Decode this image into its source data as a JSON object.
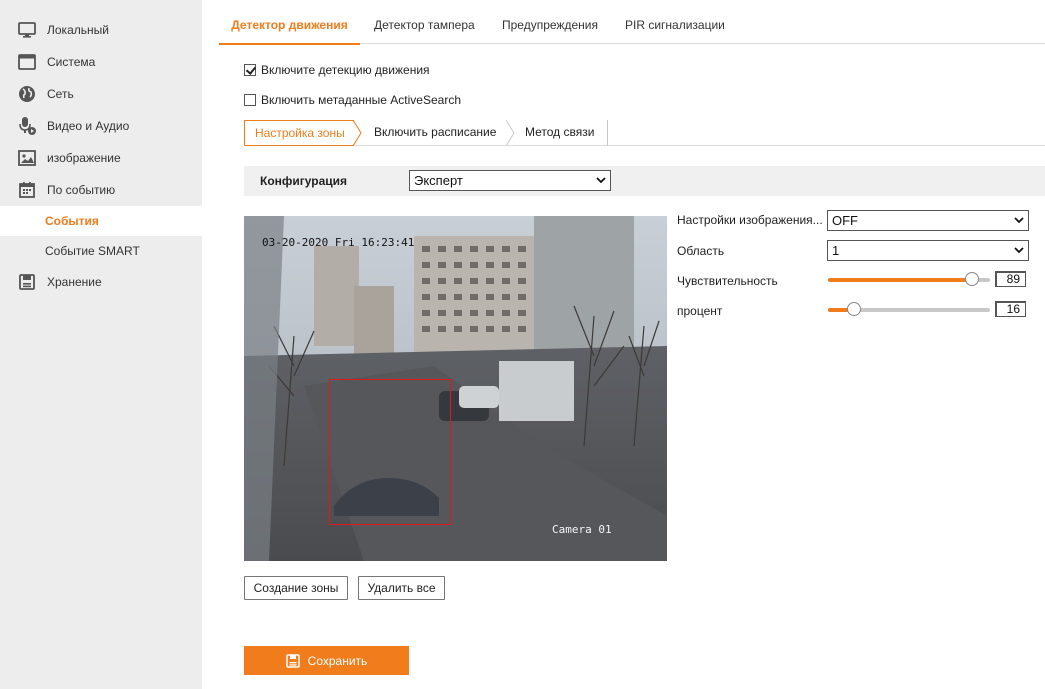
{
  "sidebar": {
    "items": [
      {
        "label": "Локальный",
        "icon": "monitor-icon"
      },
      {
        "label": "Система",
        "icon": "window-icon"
      },
      {
        "label": "Сеть",
        "icon": "globe-icon"
      },
      {
        "label": "Видео и Аудио",
        "icon": "microphone-video-icon"
      },
      {
        "label": "изображение",
        "icon": "image-icon"
      },
      {
        "label": "По событию",
        "icon": "calendar-icon"
      },
      {
        "label": "События",
        "active": true
      },
      {
        "label": "Событие SMART"
      },
      {
        "label": "Хранение",
        "icon": "storage-icon"
      }
    ]
  },
  "tabs": [
    {
      "label": "Детектор движения",
      "active": true
    },
    {
      "label": "Детектор тампера"
    },
    {
      "label": "Предупреждения"
    },
    {
      "label": "PIR сигнализации"
    }
  ],
  "options": {
    "motion_detection": {
      "label": "Включите детекцию движения",
      "checked": true
    },
    "activesearch": {
      "label": "Включить метаданные ActiveSearch",
      "checked": false
    }
  },
  "steps": [
    {
      "label": "Настройка зоны",
      "active": true
    },
    {
      "label": "Включить расписание"
    },
    {
      "label": "Метод связи"
    }
  ],
  "config": {
    "label": "Конфигурация",
    "value": "Эксперт"
  },
  "video": {
    "timestamp": "03-20-2020 Fri 16:23:41",
    "camera_name": "Camera 01"
  },
  "settings": {
    "image_settings": {
      "label": "Настройки изображения...",
      "value": "OFF"
    },
    "area": {
      "label": "Область",
      "value": "1"
    },
    "sensitivity": {
      "label": "Чувствительность",
      "value": "89"
    },
    "percent": {
      "label": "процент",
      "value": "16"
    }
  },
  "buttons": {
    "create_zone": "Создание зоны",
    "delete_all": "Удалить все",
    "save": "Сохранить"
  },
  "colors": {
    "accent": "#f07c1c",
    "zone": "#e01818"
  }
}
